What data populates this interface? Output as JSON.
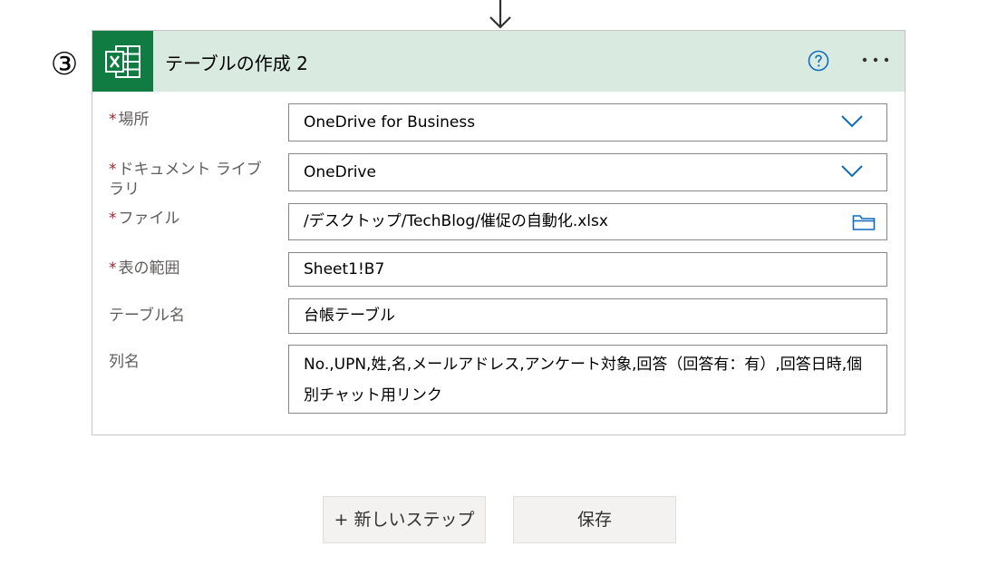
{
  "step": {
    "number": "③"
  },
  "card": {
    "title": "テーブルの作成 2",
    "accent_color": "#107c41",
    "header_color": "#d9eae1"
  },
  "fields": {
    "location": {
      "label": "場所",
      "required": "*",
      "value": "OneDrive for Business"
    },
    "document_library": {
      "label": "ドキュメント ライブラリ",
      "required": "*",
      "value": "OneDrive"
    },
    "file": {
      "label": "ファイル",
      "required": "*",
      "value": "/デスクトップ/TechBlog/催促の自動化.xlsx"
    },
    "table_range": {
      "label": "表の範囲",
      "required": "*",
      "value": "Sheet1!B7"
    },
    "table_name": {
      "label": "テーブル名",
      "value": "台帳テーブル"
    },
    "column_names": {
      "label": "列名",
      "value": "No.,UPN,姓,名,メールアドレス,アンケート対象,回答（回答有：有）,回答日時,個別チャット用リンク"
    }
  },
  "buttons": {
    "new_step": "+ 新しいステップ",
    "save": "保存"
  },
  "icons": {
    "arrow": "arrow-down-icon",
    "excel": "excel-icon",
    "help": "help-icon",
    "more": "more-icon",
    "dropdown": "chevron-down-icon",
    "folder": "folder-icon"
  }
}
